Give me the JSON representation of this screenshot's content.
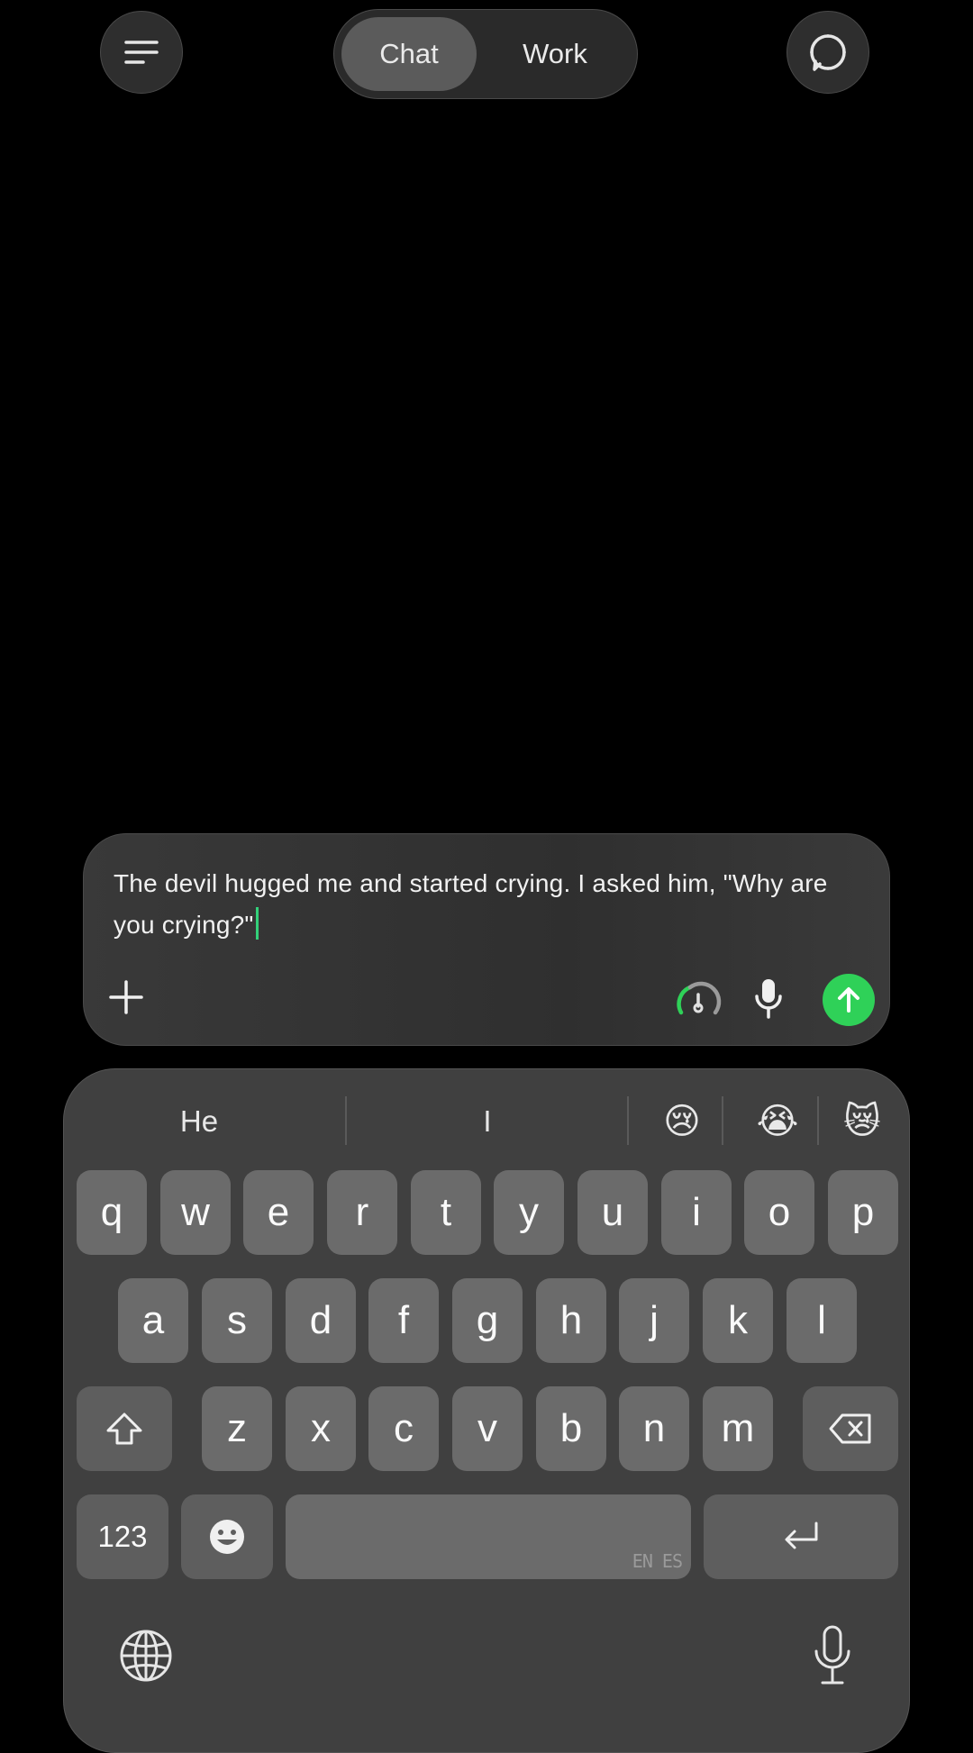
{
  "header": {
    "tabs": [
      {
        "label": "Chat",
        "active": true
      },
      {
        "label": "Work",
        "active": false
      }
    ],
    "menu_icon": "menu-icon",
    "new_chat_icon": "new-chat-icon"
  },
  "composer": {
    "text": "The devil hugged me and started crying. I asked him, \"Why are you crying?\"",
    "add_icon": "plus-icon",
    "speed_icon": "gauge-icon",
    "mic_icon": "microphone-icon",
    "send_icon": "arrow-up-icon",
    "accent": "#2fd158"
  },
  "keyboard": {
    "suggestions": [
      "He",
      "I"
    ],
    "emoji_suggestions": [
      "😢",
      "😭",
      "😿"
    ],
    "row1": [
      "q",
      "w",
      "e",
      "r",
      "t",
      "y",
      "u",
      "i",
      "o",
      "p"
    ],
    "row2": [
      "a",
      "s",
      "d",
      "f",
      "g",
      "h",
      "j",
      "k",
      "l"
    ],
    "row3": [
      "z",
      "x",
      "c",
      "v",
      "b",
      "n",
      "m"
    ],
    "numbers_label": "123",
    "space_lang": "EN ES",
    "globe_icon": "globe-icon",
    "dictation_icon": "microphone-icon"
  }
}
